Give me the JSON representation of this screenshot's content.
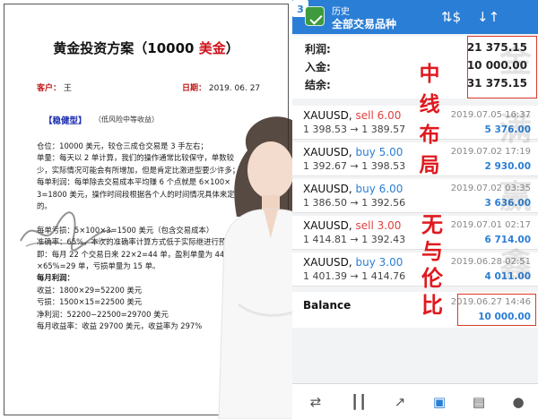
{
  "doc": {
    "title_prefix": "黄金投资方案（10000 ",
    "title_accent": "美金",
    "title_suffix": "）",
    "client_label": "客户：",
    "client_value": "王",
    "date_label": "日期：",
    "date_value": "2019. 06. 27",
    "type_tag": "【稳健型】",
    "type_note": "（低风险中等收益）",
    "lines": [
      {
        "text": "仓位：10000 美元，较仓三成仓交易是 3 手左右；",
        "bold": false
      },
      {
        "text": "单量：每天以 2 单计算，我们的操作通常比较保守，单数较",
        "bold": false
      },
      {
        "text": "少，实际情况可能会有所增加，但是肯定比激进型要少许多；",
        "bold": false
      },
      {
        "text": "每单利润：每单除去交易成本平均赚 6 个点就是 6×100×",
        "bold": false
      },
      {
        "text": "3=1800 美元，操作时间段根据各个人的时间情况具体来定",
        "bold": false
      },
      {
        "text": "的。",
        "bold": false
      },
      {
        "text": "",
        "bold": false
      },
      {
        "text": "每单亏损：5×100×3=1500 美元（包含交易成本）",
        "bold": false
      },
      {
        "text": "准确率：65%，本次的准确率计算方式低于实际继进行预估。",
        "bold": false
      },
      {
        "text": "  即：每月 22 个交易日来 22×2=44 单，盈利单量为 44",
        "bold": false
      },
      {
        "text": "×65%=29 单，亏损单量为 15 单。",
        "bold": false
      },
      {
        "text": "每月利润：",
        "bold": true
      },
      {
        "text": "收益：1800×29=52200 美元",
        "bold": false
      },
      {
        "text": "亏损：1500×15=22500 美元",
        "bold": false
      },
      {
        "text": "净利润：52200−22500=29700 美元",
        "bold": false
      },
      {
        "text": "每月收益率：收益 29700 美元，收益率为 297%",
        "bold": false
      }
    ]
  },
  "app": {
    "subtitle": "历史",
    "title": "全部交易品种",
    "calendar_day": "3",
    "icons": {
      "logo": "app-logo-icon",
      "dollar": "dollar-exchange-icon",
      "sort": "sort-arrows-icon",
      "calendar": "calendar-icon"
    },
    "summary": [
      {
        "label": "利润:",
        "value": "21 375.15"
      },
      {
        "label": "入金:",
        "value": "10 000.00"
      },
      {
        "label": "结余:",
        "value": "31 375.15"
      }
    ],
    "deals": [
      {
        "symbol": "XAUUSD,",
        "side": "sell 6.00",
        "type": "sell",
        "prices": "1 398.53 → 1 389.57",
        "time": "2019.07.05 16:37",
        "profit": "5 376.00"
      },
      {
        "symbol": "XAUUSD,",
        "side": "buy 5.00",
        "type": "buy",
        "prices": "1 392.67 → 1 398.53",
        "time": "2019.07.02 17:19",
        "profit": "2 930.00"
      },
      {
        "symbol": "XAUUSD,",
        "side": "buy 6.00",
        "type": "buy",
        "prices": "1 386.50 → 1 392.56",
        "time": "2019.07.02 03:35",
        "profit": "3 636.00"
      },
      {
        "symbol": "XAUUSD,",
        "side": "sell 3.00",
        "type": "sell",
        "prices": "1 414.81 → 1 392.43",
        "time": "2019.07.01 02:17",
        "profit": "6 714.00"
      },
      {
        "symbol": "XAUUSD,",
        "side": "buy 3.00",
        "type": "buy",
        "prices": "1 401.39 → 1 414.76",
        "time": "2019.06.28 02:51",
        "profit": "4 011.00"
      }
    ],
    "balance": {
      "label": "Balance",
      "time": "2019.06.27 14:46",
      "value": "10 000.00"
    },
    "slogan_a": [
      "中",
      "线",
      "布",
      "局"
    ],
    "slogan_b": [
      "无",
      "与",
      "伦",
      "比"
    ],
    "watermark": [
      "金",
      "满",
      "赢",
      "鑫"
    ],
    "bottom_icons": [
      "trade-icon",
      "chart-candles-icon",
      "trend-icon",
      "history-inbox-icon",
      "news-icon",
      "chat-icon"
    ],
    "colors": {
      "accent": "#2b7ed6",
      "sell": "#e04040",
      "highlight": "#d83a2a",
      "slogan": "#e0191f"
    }
  }
}
